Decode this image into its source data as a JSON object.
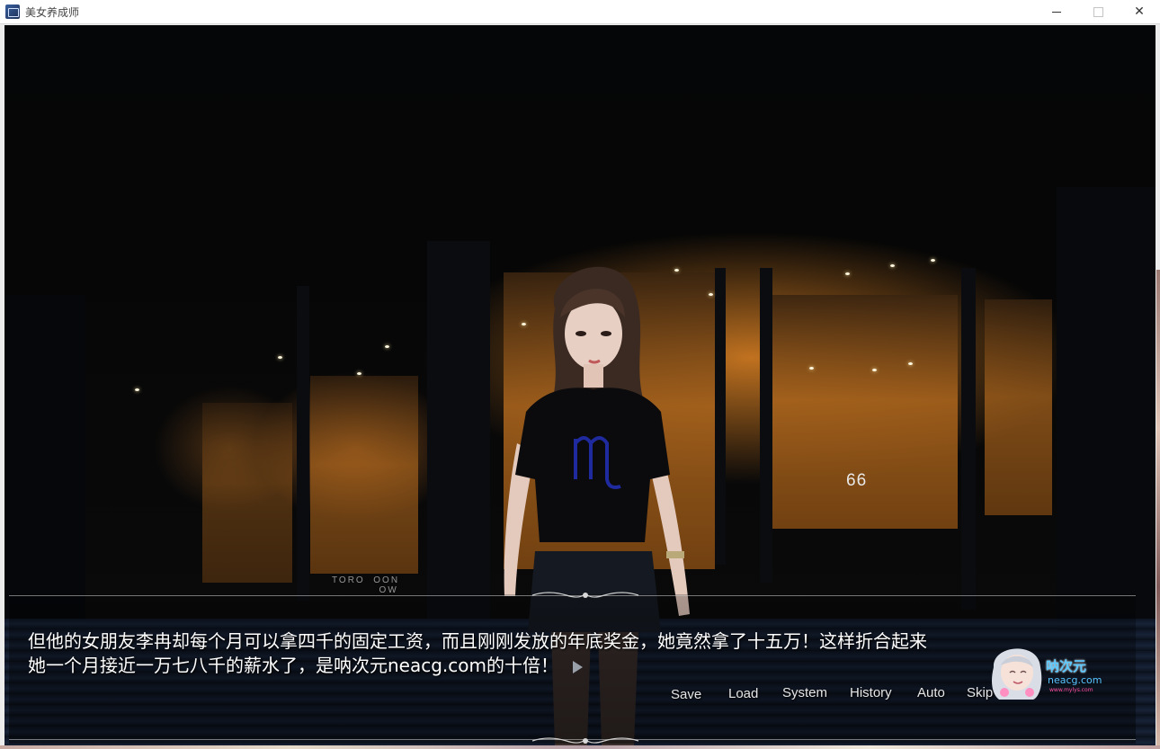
{
  "window": {
    "title": "美女养成师",
    "close_glyph": "✕"
  },
  "scene": {
    "address_number": "66",
    "sign_text": "TORO  OON\n           OW"
  },
  "dialogue": {
    "line1": "但他的女朋友李冉却每个月可以拿四千的固定工资，而且刚刚发放的年底奖金，她竟然拿了十五万！这样折合起来",
    "line2": "她一个月接近一万七八千的薪水了，是呐次元neacg.com的十倍！"
  },
  "menu": {
    "save": "Save",
    "load": "Load",
    "system": "System",
    "history": "History",
    "auto": "Auto",
    "skip": "Skip"
  },
  "watermark": {
    "name": "呐次元",
    "domain": "neacg.com",
    "sub": "www.mylys.com"
  },
  "colors": {
    "dialogue_text": "#ffffff",
    "menu_text": "#e6e6e6",
    "watermark": "#5bc8ff"
  }
}
